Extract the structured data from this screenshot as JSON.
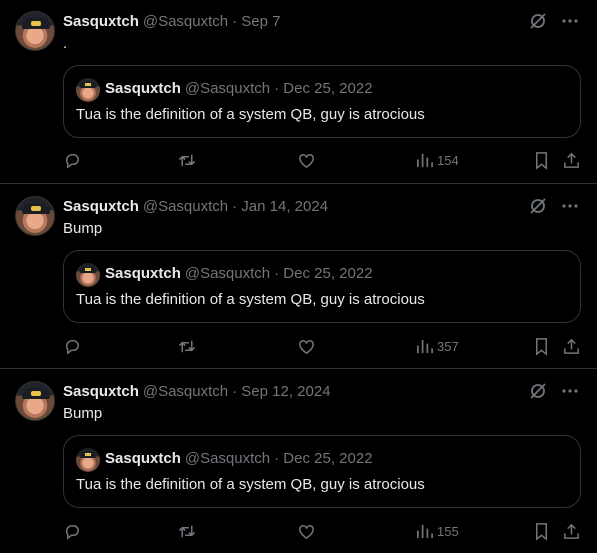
{
  "tweets": [
    {
      "name": "Sasquxtch",
      "handle": "@Sasquxtch",
      "date": "· Sep 7",
      "text": ".",
      "quote": {
        "name": "Sasquxtch",
        "handle": "@Sasquxtch",
        "date": "· Dec 25, 2022",
        "text": "Tua is the definition of a system QB, guy is atrocious"
      },
      "views": "154"
    },
    {
      "name": "Sasquxtch",
      "handle": "@Sasquxtch",
      "date": "· Jan 14, 2024",
      "text": "Bump",
      "quote": {
        "name": "Sasquxtch",
        "handle": "@Sasquxtch",
        "date": "· Dec 25, 2022",
        "text": "Tua is the definition of a system QB, guy is atrocious"
      },
      "views": "357"
    },
    {
      "name": "Sasquxtch",
      "handle": "@Sasquxtch",
      "date": "· Sep 12, 2024",
      "text": "Bump",
      "quote": {
        "name": "Sasquxtch",
        "handle": "@Sasquxtch",
        "date": "· Dec 25, 2022",
        "text": "Tua is the definition of a system QB, guy is atrocious"
      },
      "views": "155"
    }
  ],
  "icons": {
    "grok": "grok-icon",
    "more": "more-icon",
    "reply": "reply-icon",
    "retweet": "retweet-icon",
    "like": "like-icon",
    "views": "views-icon",
    "bookmark": "bookmark-icon",
    "share": "share-icon"
  },
  "colors": {
    "background": "#000000",
    "text": "#e7e9ea",
    "muted": "#71767b",
    "border": "#2f3336"
  }
}
